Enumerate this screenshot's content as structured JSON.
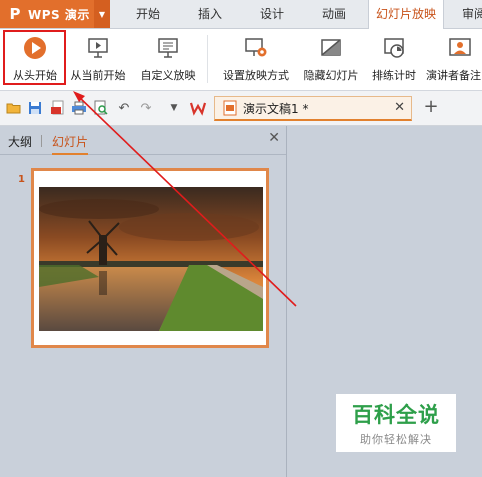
{
  "app": {
    "title": "WPS 演示",
    "logo": "P"
  },
  "tabs": [
    {
      "label": "开始"
    },
    {
      "label": "插入"
    },
    {
      "label": "设计"
    },
    {
      "label": "动画"
    },
    {
      "label": "幻灯片放映"
    },
    {
      "label": "审阅"
    }
  ],
  "ribbon": {
    "from_start": "从头开始",
    "from_current": "从当前开始",
    "custom_show": "自定义放映",
    "setup_show": "设置放映方式",
    "hide_slide": "隐藏幻灯片",
    "rehearse": "排练计时",
    "presenter_notes": "演讲者备注"
  },
  "doc_tab": {
    "name": "演示文稿1 *"
  },
  "panel": {
    "outline_tab": "大纲",
    "slides_tab": "幻灯片",
    "slide_number": "1"
  },
  "watermark": {
    "title": "百科全说",
    "subtitle": "助你轻松解决"
  },
  "colors": {
    "accent": "#e26f2c",
    "highlight_box": "#e01c1c",
    "arrow": "#e01c1c"
  }
}
